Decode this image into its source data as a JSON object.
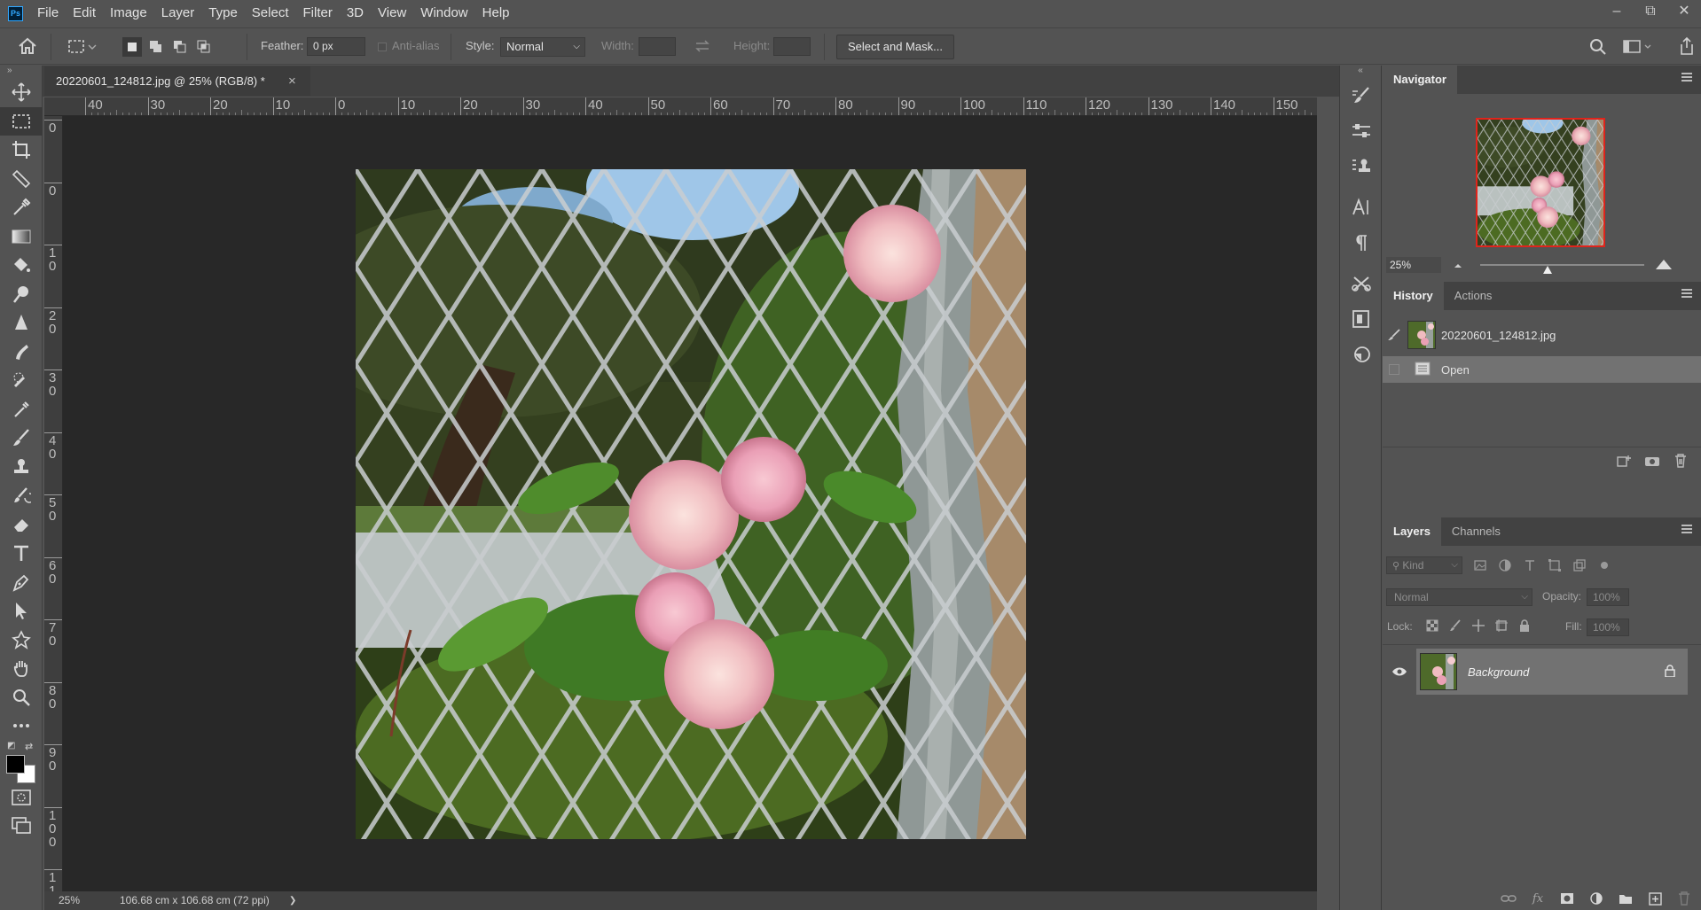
{
  "app": {
    "logo": "Ps"
  },
  "menu": [
    "File",
    "Edit",
    "Image",
    "Layer",
    "Type",
    "Select",
    "Filter",
    "3D",
    "View",
    "Window",
    "Help"
  ],
  "window_controls": {
    "minimize": "–",
    "restore": "⧉",
    "close": "✕"
  },
  "options": {
    "feather_label": "Feather:",
    "feather_value": "0 px",
    "antialias_label": "Anti-alias",
    "style_label": "Style:",
    "style_value": "Normal",
    "width_label": "Width:",
    "height_label": "Height:",
    "select_mask_label": "Select and Mask..."
  },
  "document": {
    "tab_title": "20220601_124812.jpg @ 25% (RGB/8) *",
    "close": "×"
  },
  "rulers": {
    "top_ticks": [
      "40",
      "30",
      "20",
      "10",
      "0",
      "10",
      "20",
      "30",
      "40",
      "50",
      "60",
      "70",
      "80",
      "90",
      "100",
      "110",
      "120",
      "130",
      "140",
      "150"
    ],
    "left_ticks": [
      [
        "0"
      ],
      [
        "0"
      ],
      [
        "1",
        "0"
      ],
      [
        "2",
        "0"
      ],
      [
        "3",
        "0"
      ],
      [
        "4",
        "0"
      ],
      [
        "5",
        "0"
      ],
      [
        "6",
        "0"
      ],
      [
        "7",
        "0"
      ],
      [
        "8",
        "0"
      ],
      [
        "9",
        "0"
      ],
      [
        "1",
        "0",
        "0"
      ],
      [
        "1",
        "1"
      ]
    ]
  },
  "status": {
    "zoom": "25%",
    "dimensions": "106.68 cm x 106.68 cm (72 ppi)",
    "arrow": "❯"
  },
  "navigator": {
    "tab": "Navigator",
    "zoom": "25%",
    "zoom_slider_fraction": 0.41
  },
  "history": {
    "tabs": [
      "History",
      "Actions"
    ],
    "snapshot_name": "20220601_124812.jpg",
    "step": "Open"
  },
  "layers": {
    "tabs": [
      "Layers",
      "Channels"
    ],
    "filter_kind": "Kind",
    "blend_mode": "Normal",
    "opacity_label": "Opacity:",
    "opacity_value": "100%",
    "lock_label": "Lock:",
    "fill_label": "Fill:",
    "fill_value": "100%",
    "layer_name": "Background"
  },
  "colors": {
    "accent": "#31a8ff",
    "navigator_frame": "#e0241c",
    "foreground": "#000000",
    "background": "#ffffff"
  },
  "tools": [
    "move-icon",
    "marquee-icon",
    "crop-icon",
    "frame-icon",
    "eyedropper-icon",
    "gradient-icon",
    "paint-bucket-icon",
    "dodge-icon",
    "sharpen-icon",
    "smudge-icon",
    "spot-healing-icon",
    "color-replacement-icon",
    "brush-icon",
    "clone-stamp-icon",
    "history-brush-icon",
    "eraser-icon",
    "type-icon",
    "pen-icon",
    "path-selection-icon",
    "shape-icon",
    "hand-icon",
    "zoom-icon",
    "more-tools-icon"
  ]
}
